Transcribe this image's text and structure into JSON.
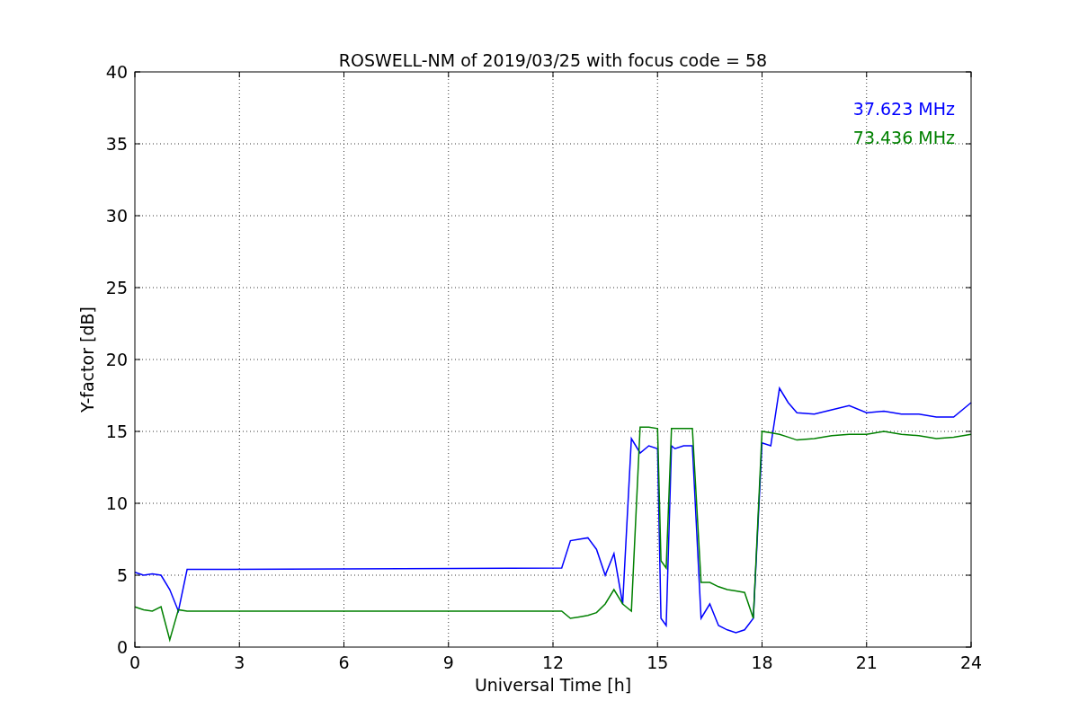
{
  "chart": {
    "chart_data": {
      "type": "line",
      "title": "ROSWELL-NM of 2019/03/25 with focus code = 58",
      "xlabel": "Universal Time [h]",
      "ylabel": "Y-factor [dB]",
      "x": [
        0,
        0.25,
        0.5,
        0.75,
        1,
        1.25,
        1.5,
        12.25,
        12.5,
        12.75,
        13,
        13.25,
        13.5,
        13.75,
        14,
        14.25,
        14.5,
        14.75,
        15,
        15.1,
        15.25,
        15.4,
        15.5,
        15.75,
        16,
        16.25,
        16.5,
        16.75,
        17,
        17.25,
        17.5,
        17.75,
        18,
        18.25,
        18.5,
        18.75,
        19,
        19.5,
        20,
        20.5,
        21,
        21.5,
        22,
        22.5,
        23,
        23.5,
        24
      ],
      "series": [
        {
          "name": "37.623 MHz",
          "color": "#0000ff",
          "values": [
            5.2,
            5.0,
            5.1,
            5.0,
            4.0,
            2.5,
            5.4,
            5.5,
            7.4,
            7.5,
            7.6,
            6.8,
            5.0,
            6.5,
            3.0,
            14.5,
            13.5,
            14.0,
            13.8,
            2.0,
            1.5,
            14.0,
            13.8,
            14.0,
            14.0,
            2.0,
            3.0,
            1.5,
            1.2,
            1.0,
            1.2,
            2.0,
            14.2,
            14.0,
            18.0,
            17.0,
            16.3,
            16.2,
            16.5,
            16.8,
            16.3,
            16.4,
            16.2,
            16.2,
            16.0,
            16.0,
            17.0
          ]
        },
        {
          "name": "73.436 MHz",
          "color": "#008000",
          "values": [
            2.8,
            2.6,
            2.5,
            2.8,
            0.5,
            2.6,
            2.5,
            2.5,
            2.0,
            2.1,
            2.2,
            2.4,
            3.0,
            4.0,
            3.0,
            2.5,
            15.3,
            15.3,
            15.2,
            6.0,
            5.5,
            15.2,
            15.2,
            15.2,
            15.2,
            4.5,
            4.5,
            4.2,
            4.0,
            3.9,
            3.8,
            2.0,
            15.0,
            14.9,
            14.8,
            14.6,
            14.4,
            14.5,
            14.7,
            14.8,
            14.8,
            15.0,
            14.8,
            14.7,
            14.5,
            14.6,
            14.8
          ]
        }
      ],
      "grid": true,
      "xlim": [
        0,
        24
      ],
      "ylim": [
        0,
        40
      ],
      "xticks": [
        0,
        3,
        6,
        9,
        12,
        15,
        18,
        21,
        24
      ],
      "yticks": [
        0,
        5,
        10,
        15,
        20,
        25,
        30,
        35,
        40
      ]
    }
  }
}
